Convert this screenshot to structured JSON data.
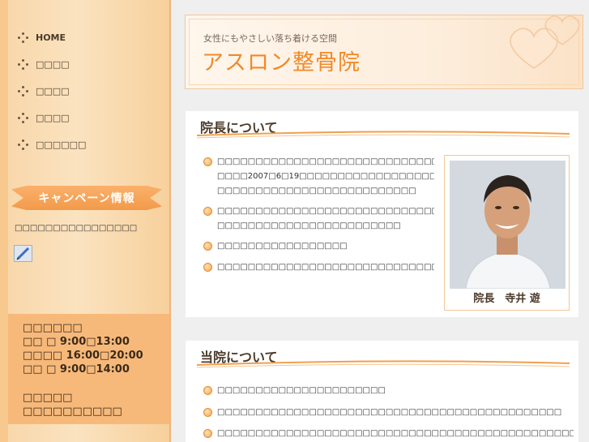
{
  "nav": {
    "items": [
      {
        "label": "HOME"
      },
      {
        "label": "□□□□"
      },
      {
        "label": "□□□□"
      },
      {
        "label": "□□□□"
      },
      {
        "label": "□□□□□□"
      }
    ]
  },
  "campaign": {
    "banner": "キャンペーン情報",
    "text": "□□□□□□□□□□□□□□□□"
  },
  "hours": {
    "line1": "□□□□□□",
    "line2": "□□ □ 9:00□13:00",
    "line3": "□□□□ 16:00□20:00",
    "line4": "□□ □ 9:00□14:00",
    "line5": "□□□□□",
    "line6": "□□□□□□□□□□"
  },
  "header": {
    "tagline": "女性にもやさしい落ち着ける空間",
    "clinic_name": "アスロン整骨院"
  },
  "about_director": {
    "title": "院長について",
    "items": [
      {
        "line1": "□□□□□□□□□□□□□□□□□□□□□□□□□□□□□□□□□□□□□□□□□",
        "line2": "□□□□2007□6□19□□□□□□□□□□□□□□□□□□□□□□□□□□□□□□□□",
        "line3": "□□□□□□□□□□□□□□□□□□□□□□□□□□"
      },
      {
        "line1": "□□□□□□□□□□□□□□□□□□□□□□□□□□□□□□□□□□□□□□□□□",
        "line2": "□□□□□□□□□□□□□□□□□□□□□□□□"
      },
      {
        "line1": "□□□□□□□□□□□□□□□□□"
      },
      {
        "line1": "□□□□□□□□□□□□□□□□□□□□□□□□□□□□□□□□□□□□□□□"
      }
    ],
    "caption": "院長　寺井 遊"
  },
  "about_clinic": {
    "title": "当院について",
    "items": [
      {
        "line1": "□□□□□□□□□□□□□□□□□□□□□□"
      },
      {
        "line1": "□□□□□□□□□□□□□□□□□□□□□□□□□□□□□□□□□□□□□□□□□□□□□"
      },
      {
        "line1": "□□□□□□□□□□□□□□□□□□□□□□□□□□□□□□□□□□□□□□□□□□□□□□□□□□□□□□"
      }
    ]
  },
  "colors": {
    "accent": "#f08a2a",
    "sidebar": "#fbe3c0"
  }
}
